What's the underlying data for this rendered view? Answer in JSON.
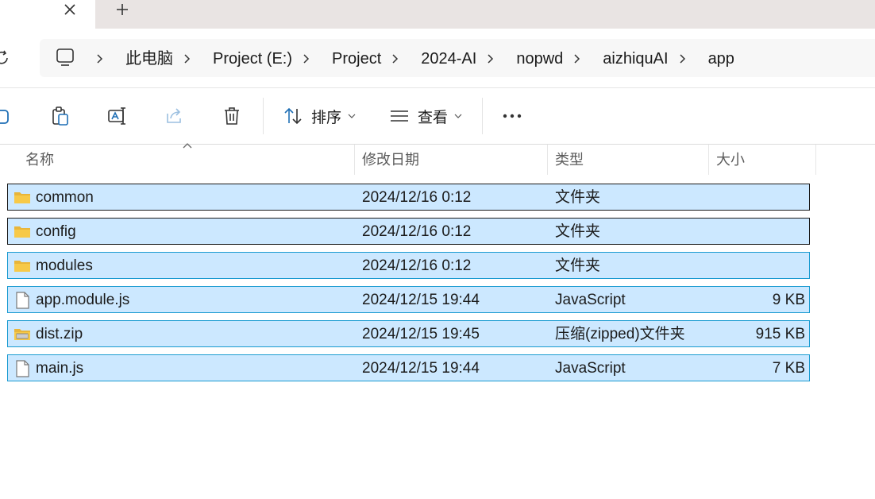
{
  "breadcrumbs": [
    "此电脑",
    "Project (E:)",
    "Project",
    "2024-AI",
    "nopwd",
    "aizhiquAI",
    "app"
  ],
  "toolbar": {
    "sort_label": "排序",
    "view_label": "查看"
  },
  "columns": {
    "name": "名称",
    "date": "修改日期",
    "type": "类型",
    "size": "大小"
  },
  "files": [
    {
      "name": "common",
      "date": "2024/12/16 0:12",
      "type": "文件夹",
      "size": "",
      "icon": "folder-icon"
    },
    {
      "name": "config",
      "date": "2024/12/16 0:12",
      "type": "文件夹",
      "size": "",
      "icon": "folder-icon"
    },
    {
      "name": "modules",
      "date": "2024/12/16 0:12",
      "type": "文件夹",
      "size": "",
      "icon": "folder-icon"
    },
    {
      "name": "app.module.js",
      "date": "2024/12/15 19:44",
      "type": "JavaScript",
      "size": "9 KB",
      "icon": "file-icon"
    },
    {
      "name": "dist.zip",
      "date": "2024/12/15 19:45",
      "type": "压缩(zipped)文件夹",
      "size": "915 KB",
      "icon": "zip-folder-icon"
    },
    {
      "name": "main.js",
      "date": "2024/12/15 19:44",
      "type": "JavaScript",
      "size": "7 KB",
      "icon": "file-icon"
    }
  ],
  "colors": {
    "selection_bg": "#cce8ff",
    "selection_border": "#1a9bd1",
    "focus_border": "#1a1a1a",
    "folder_yellow": "#f7c948"
  }
}
